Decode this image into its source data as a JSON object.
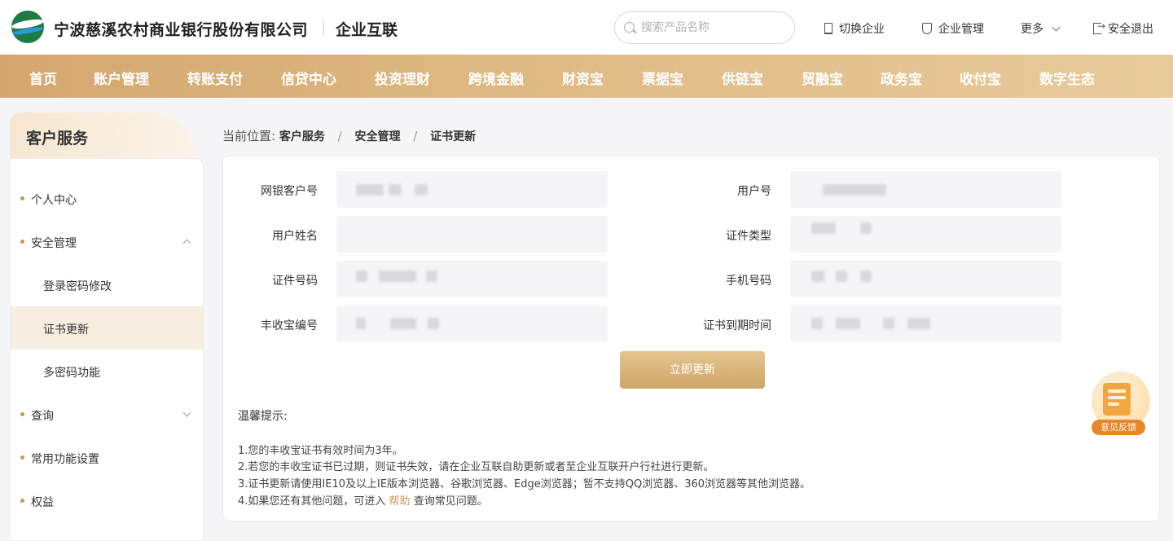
{
  "header": {
    "bank_name": "宁波慈溪农村商业银行股份有限公司",
    "subsite": "企业互联",
    "search_placeholder": "搜索产品名称",
    "links": {
      "switch": "切换企业",
      "manage": "企业管理",
      "more": "更多",
      "logout": "安全退出"
    }
  },
  "nav": [
    "首页",
    "账户管理",
    "转账支付",
    "信贷中心",
    "投资理财",
    "跨境金融",
    "财资宝",
    "票据宝",
    "供链宝",
    "贸融宝",
    "政务宝",
    "收付宝",
    "数字生态"
  ],
  "sidebar": {
    "title": "客户服务",
    "items": [
      "个人中心",
      "安全管理",
      "登录密码修改",
      "证书更新",
      "多密码功能",
      "查询",
      "常用功能设置",
      "权益"
    ]
  },
  "breadcrumb": {
    "prefix": "当前位置:",
    "levels": [
      "客户服务",
      "安全管理",
      "证书更新"
    ]
  },
  "form": {
    "fields": {
      "customer_no": "网银客户号",
      "user_no": "用户号",
      "user_name": "用户姓名",
      "cert_type": "证件类型",
      "cert_no": "证件号码",
      "mobile": "手机号码",
      "token_no": "丰收宝编号",
      "expire_time": "证书到期时间"
    },
    "submit": "立即更新"
  },
  "tips": {
    "title": "温馨提示:",
    "lines": [
      "1.您的丰收宝证书有效时间为3年。",
      "2.若您的丰收宝证书已过期，则证书失效，请在企业互联自助更新或者至企业互联开户行社进行更新。",
      "3.证书更新请使用IE10及以上IE版本浏览器、谷歌浏览器、Edge浏览器；暂不支持QQ浏览器、360浏览器等其他浏览器。"
    ],
    "line4_before": "4.如果您还有其他问题，可进入",
    "line4_link": "帮助",
    "line4_after": "查询常见问题。"
  },
  "feedback": "意见反馈",
  "colors": {
    "nav_gold": "#d4a76e",
    "accent": "#c99a58",
    "feedback_orange": "#e9862a"
  }
}
